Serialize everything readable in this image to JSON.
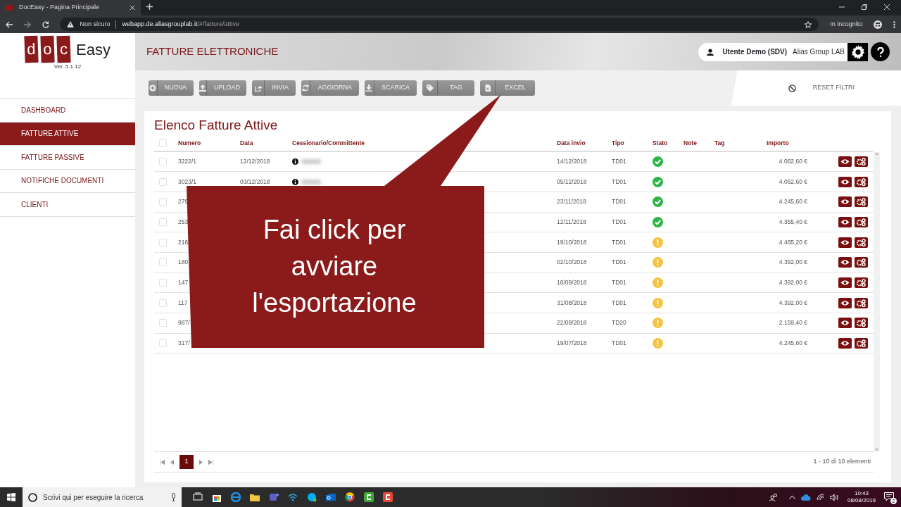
{
  "browser": {
    "tab_title": "DocEasy - Pagina Principale",
    "security_label": "Non sicuro",
    "url_host": "webapp.de.aliasgrouplab.it",
    "url_path": "/#/fatture/attive",
    "incognito_label": "In incognito"
  },
  "logo": {
    "boxed_letters": [
      "d",
      "o",
      "c"
    ],
    "word": "Easy",
    "version": "Ver. 5.1.12"
  },
  "sidebar": {
    "items": [
      {
        "label": "DASHBOARD",
        "selected": false
      },
      {
        "label": "FATTURE ATTIVE",
        "selected": true
      },
      {
        "label": "FATTURE PASSIVE",
        "selected": false
      },
      {
        "label": "NOTIFICHE DOCUMENTI",
        "selected": false
      },
      {
        "label": "CLIENTI",
        "selected": false
      }
    ]
  },
  "header": {
    "title": "FATTURE ELETTRONICHE",
    "user_name": "Utente Demo (SDV)",
    "company": "Alias Group LAB"
  },
  "toolbar": {
    "buttons": [
      {
        "label": "NUOVA",
        "kind": "plus"
      },
      {
        "label": "UPLOAD",
        "kind": "upload"
      },
      {
        "label": "INVIA",
        "kind": "share"
      },
      {
        "label": "AGGIORNA",
        "kind": "refresh"
      },
      {
        "label": "SCARICA",
        "kind": "download"
      },
      {
        "label": "TAG",
        "kind": "tag"
      },
      {
        "label": "EXCEL",
        "kind": "file"
      }
    ],
    "reset_label": "RESET FILTRI"
  },
  "list": {
    "title": "Elenco Fatture Attive",
    "columns": [
      "Numero",
      "Data",
      "Cessionario/Committente",
      "Data invio",
      "Tipo",
      "Stato",
      "Note",
      "Tag",
      "Importo"
    ],
    "select_all_checked": false,
    "rows": [
      {
        "checked": false,
        "numero": "3222/1",
        "data": "12/12/2018",
        "redacted": true,
        "data_invio": "14/12/2018",
        "tipo": "TD01",
        "kind": "ok",
        "importo": "4.062,60 €"
      },
      {
        "checked": false,
        "numero": "3023/1",
        "data": "03/12/2018",
        "redacted": true,
        "data_invio": "05/12/2018",
        "tipo": "TD01",
        "kind": "ok",
        "importo": "4.062,60 €"
      },
      {
        "checked": false,
        "numero": "279",
        "data_invio": "23/11/2018",
        "tipo": "TD01",
        "kind": "ok",
        "importo": "4.245,60 €"
      },
      {
        "checked": false,
        "numero": "253",
        "data_invio": "12/11/2018",
        "tipo": "TD01",
        "kind": "ok",
        "importo": "4.355,40 €"
      },
      {
        "checked": false,
        "numero": "216",
        "data_invio": "19/10/2018",
        "tipo": "TD01",
        "kind": "warning",
        "importo": "4.465,20 €"
      },
      {
        "checked": false,
        "numero": "180",
        "data_invio": "02/10/2018",
        "tipo": "TD01",
        "kind": "warning",
        "importo": "4.392,00 €"
      },
      {
        "checked": false,
        "numero": "147",
        "data_invio": "18/09/2018",
        "tipo": "TD01",
        "kind": "warning",
        "importo": "4.392,00 €"
      },
      {
        "checked": false,
        "numero": "117",
        "data_invio": "31/08/2018",
        "tipo": "TD01",
        "kind": "warning",
        "importo": "4.392,00 €"
      },
      {
        "checked": false,
        "numero": "987/",
        "data_invio": "22/08/2018",
        "tipo": "TD20",
        "kind": "warning",
        "importo": "2.159,40 €"
      },
      {
        "checked": false,
        "numero": "317/",
        "data_invio": "19/07/2018",
        "tipo": "TD01",
        "kind": "warning",
        "importo": "4.245,60 €"
      }
    ],
    "pages": [
      {
        "label": "1",
        "selected": true
      }
    ],
    "summary": "1 - 10 di 10 elementi"
  },
  "callout": {
    "text": "Fai click per avviare l'esportazione"
  },
  "taskbar": {
    "search_placeholder": "Scrivi qui per eseguire la ricerca",
    "time": "10:43",
    "date": "08/08/2019",
    "notifications": "2"
  }
}
